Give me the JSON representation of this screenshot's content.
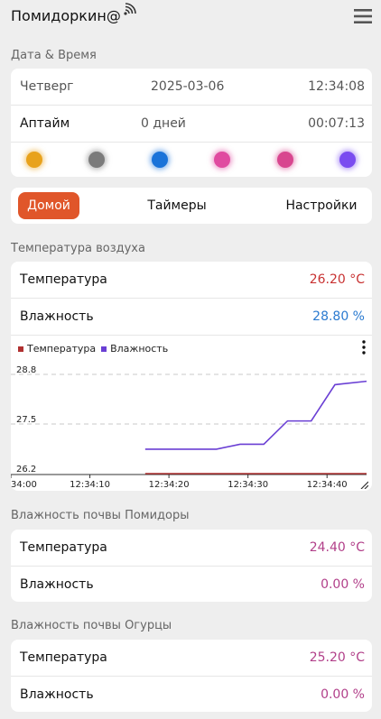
{
  "header": {
    "title": "Помидоркин@",
    "wifi_icon": "wifi-icon",
    "menu_icon": "hamburger-menu-icon"
  },
  "datetime": {
    "section_title": "Дата & Время",
    "day": "Четверг",
    "date": "2025-03-06",
    "time": "12:34:08",
    "uptime_label": "Аптайм",
    "uptime_days": "0 дней",
    "uptime_time": "00:07:13",
    "dots": [
      "#e8a21c",
      "#7b7b7b",
      "#1a73d9",
      "#e04ba0",
      "#d8468f",
      "#7a4cf0"
    ]
  },
  "tabs": [
    {
      "label": "Домой",
      "active": true
    },
    {
      "label": "Таймеры",
      "active": false
    },
    {
      "label": "Настройки",
      "active": false
    }
  ],
  "air": {
    "section_title": "Температура воздуха",
    "temp_label": "Температура",
    "temp_value": "26.20 °C",
    "hum_label": "Влажность",
    "hum_value": "28.80 %",
    "temp_color": "#c83232",
    "hum_color": "#2a7ad0"
  },
  "chart_data": {
    "type": "line",
    "legend": [
      "Температура",
      "Влажность"
    ],
    "legend_placement": "top-left",
    "yticks": [
      "28.8",
      "27.5",
      "26.2"
    ],
    "xticks": [
      "34:00",
      "12:34:10",
      "12:34:20",
      "12:34:30",
      "12:34:40"
    ],
    "ylim": [
      26.2,
      28.8
    ],
    "xlim": [
      0,
      45
    ],
    "series": [
      {
        "name": "Температура",
        "color": "#b03030",
        "x": [
          17,
          45
        ],
        "y": [
          26.2,
          26.2
        ]
      },
      {
        "name": "Влажность",
        "color": "#6a3fd4",
        "x": [
          17,
          20,
          23,
          26,
          29,
          32,
          35,
          38,
          41,
          45
        ],
        "y": [
          26.84,
          26.84,
          26.84,
          26.84,
          26.97,
          26.97,
          27.58,
          27.58,
          28.53,
          28.62
        ]
      }
    ],
    "grid": "dashed-horizontal"
  },
  "soil_tomato": {
    "section_title": "Влажность почвы Помидоры",
    "temp_label": "Температура",
    "temp_value": "24.40 °C",
    "hum_label": "Влажность",
    "hum_value": "0.00 %",
    "value_color": "#b2408a"
  },
  "soil_cucumber": {
    "section_title": "Влажность почвы Огурцы",
    "temp_label": "Температура",
    "temp_value": "25.20 °C",
    "hum_label": "Влажность",
    "hum_value": "0.00 %",
    "value_color": "#b2408a"
  }
}
